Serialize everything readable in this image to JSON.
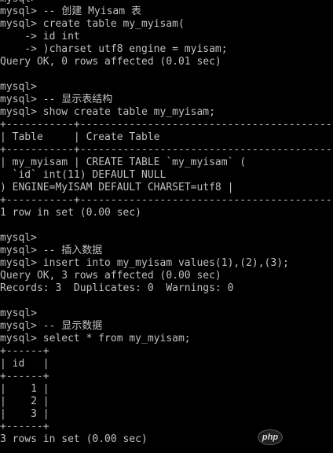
{
  "terminal": {
    "lines": [
      "mysql>",
      "mysql> -- 创建 Myisam 表",
      "mysql> create table my_myisam(",
      "    -> id int",
      "    -> )charset utf8 engine = myisam;",
      "Query OK, 0 rows affected (0.01 sec)",
      "",
      "mysql>",
      "mysql> -- 显示表结构",
      "mysql> show create table my_myisam;",
      "+-----------+----------------------------------------------------",
      "| Table     | Create Table",
      "+-----------+----------------------------------------------------",
      "| my_myisam | CREATE TABLE `my_myisam` (",
      "  `id` int(11) DEFAULT NULL",
      ") ENGINE=MyISAM DEFAULT CHARSET=utf8 |",
      "+-----------+----------------------------------------------------",
      "1 row in set (0.00 sec)",
      "",
      "mysql>",
      "mysql> -- 插入数据",
      "mysql> insert into my_myisam values(1),(2),(3);",
      "Query OK, 3 rows affected (0.00 sec)",
      "Records: 3  Duplicates: 0  Warnings: 0",
      "",
      "mysql>",
      "mysql> -- 显示数据",
      "mysql> select * from my_myisam;",
      "+------+",
      "| id   |",
      "+------+",
      "|    1 |",
      "|    2 |",
      "|    3 |",
      "+------+",
      "3 rows in set (0.00 sec)"
    ]
  },
  "watermark": {
    "label": "php"
  },
  "colors": {
    "background": "#000000",
    "text": "#c0c0c0"
  }
}
